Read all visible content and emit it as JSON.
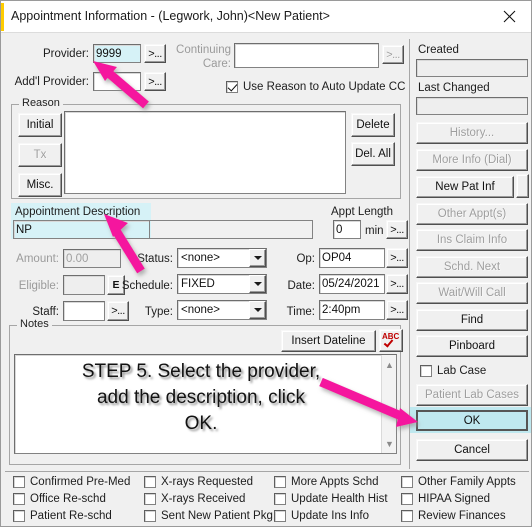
{
  "window": {
    "title": "Appointment Information - (Legwork, John)<New Patient>",
    "close_icon": "close-icon"
  },
  "provider": {
    "label": "Provider:",
    "value": "9999",
    "browse_label": ">...",
    "addl_label": "Add'l Provider:",
    "addl_value": "",
    "addl_browse_label": ">..."
  },
  "continuing_care": {
    "label_line1": "Continuing",
    "label_line2": "Care:",
    "value": "",
    "browse_label": ">...",
    "auto_update_label": "Use Reason to Auto Update CC",
    "auto_update_checked": true
  },
  "reason": {
    "group_label": "Reason",
    "initial_label": "Initial",
    "tx_label": "Tx",
    "misc_label": "Misc.",
    "delete_label": "Delete",
    "del_all_label": "Del. All",
    "list_value": ""
  },
  "appointment": {
    "description_label": "Appointment Description",
    "description_value": "NP",
    "appt_length_label": "Appt Length",
    "appt_length_value": "0",
    "min_label": "min",
    "appt_length_browse": ">...",
    "amount_label": "Amount:",
    "amount_value": "0.00",
    "eligible_label": "Eligible:",
    "eligible_value": "",
    "eligible_btn_label": "E",
    "staff_label": "Staff:",
    "staff_value": "",
    "staff_browse": ">...",
    "status_label": "Status:",
    "status_value": "<none>",
    "schedule_label": "Schedule:",
    "schedule_value": "FIXED",
    "type_label": "Type:",
    "type_value": "<none>",
    "op_label": "Op:",
    "op_value": "OP04",
    "op_browse": ">...",
    "date_label": "Date:",
    "date_value": "05/24/2021",
    "date_browse": ">...",
    "time_label": "Time:",
    "time_value": "2:40pm",
    "time_browse": ">..."
  },
  "notes": {
    "group_label": "Notes",
    "insert_dateline_label": "Insert Dateline",
    "spellcheck_icon": "abc-spellcheck-icon",
    "spellcheck_text": "ABC",
    "text": ""
  },
  "annotation": {
    "line1": "STEP 5. Select the provider,",
    "line2": "add the description, click",
    "line3": "OK.",
    "arrow_color": "#f5189e"
  },
  "right_panel": {
    "created_label": "Created",
    "created_value": "",
    "last_changed_label": "Last Changed",
    "last_changed_value": "",
    "buttons": [
      {
        "label": "History...",
        "enabled": false,
        "highlight": false
      },
      {
        "label": "More Info (Dial)",
        "enabled": false,
        "highlight": false
      },
      {
        "label": "New Pat Inf",
        "enabled": true,
        "highlight": false
      },
      {
        "label": "Other Appt(s)",
        "enabled": false,
        "highlight": false
      },
      {
        "label": "Ins Claim Info",
        "enabled": false,
        "highlight": false
      },
      {
        "label": "Schd. Next",
        "enabled": false,
        "highlight": false
      },
      {
        "label": "Wait/Will Call",
        "enabled": false,
        "highlight": false
      },
      {
        "label": "Find",
        "enabled": true,
        "highlight": false
      },
      {
        "label": "Pinboard",
        "enabled": true,
        "highlight": false
      }
    ],
    "lab_case_label": "Lab Case",
    "lab_case_checked": false,
    "patient_lab_cases_label": "Patient Lab Cases",
    "ok_label": "OK",
    "cancel_label": "Cancel"
  },
  "status_checkboxes": {
    "col1": [
      {
        "label": "Confirmed Pre-Med",
        "checked": false
      },
      {
        "label": "Office Re-schd",
        "checked": false
      },
      {
        "label": "Patient Re-schd",
        "checked": false
      }
    ],
    "col2": [
      {
        "label": "X-rays Requested",
        "checked": false
      },
      {
        "label": "X-rays Received",
        "checked": false
      },
      {
        "label": "Sent New Patient Pkg",
        "checked": false
      }
    ],
    "col3": [
      {
        "label": "More Appts Schd",
        "checked": false
      },
      {
        "label": "Update Health Hist",
        "checked": false
      },
      {
        "label": "Update Ins Info",
        "checked": false
      }
    ],
    "col4": [
      {
        "label": "Other Family Appts",
        "checked": false
      },
      {
        "label": "HIPAA Signed",
        "checked": false
      },
      {
        "label": "Review Finances",
        "checked": false
      }
    ]
  },
  "colors": {
    "highlight": "#d6f2f7",
    "button_highlight": "#bfe8ef",
    "arrow": "#f5189e",
    "title_accent": "#ffcc00"
  }
}
